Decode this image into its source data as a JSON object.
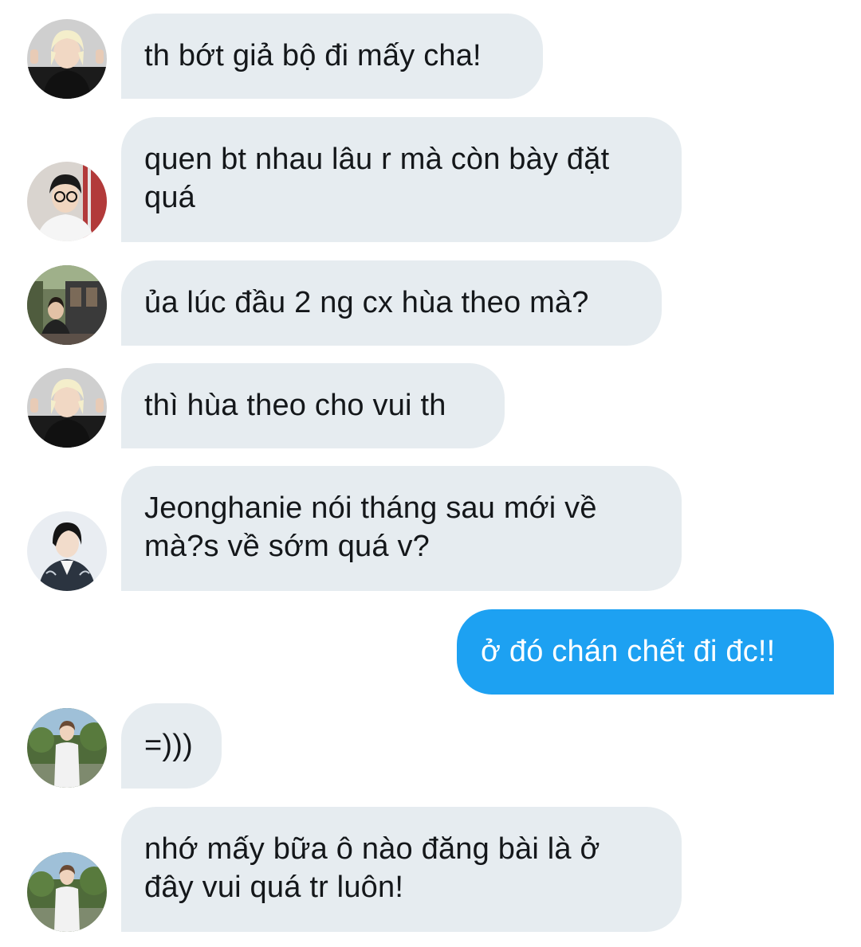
{
  "messages": [
    {
      "direction": "in",
      "avatar": "avatar-blonde",
      "text": "th bớt giả bộ đi mấy cha!"
    },
    {
      "direction": "in",
      "avatar": "avatar-glasses",
      "text": "quen bt nhau lâu r mà còn bày đặt quá"
    },
    {
      "direction": "in",
      "avatar": "avatar-street",
      "text": "ủa lúc đầu 2 ng cx hùa theo mà?"
    },
    {
      "direction": "in",
      "avatar": "avatar-blonde",
      "text": "thì hùa theo cho vui th"
    },
    {
      "direction": "in",
      "avatar": "avatar-jacket",
      "text": "Jeonghanie nói tháng sau mới về mà?s về sớm quá v?"
    },
    {
      "direction": "out",
      "avatar": null,
      "text": "ở đó chán chết đi đc!!"
    },
    {
      "direction": "in",
      "avatar": "avatar-outdoor",
      "text": "=)))"
    },
    {
      "direction": "in",
      "avatar": "avatar-outdoor",
      "text": "nhớ mấy bữa ô nào đăng bài là ở đây vui quá tr luôn!"
    }
  ],
  "colors": {
    "incoming_bubble": "#e6ecf0",
    "outgoing_bubble": "#1da1f2",
    "text_dark": "#14171a",
    "text_light": "#ffffff"
  }
}
